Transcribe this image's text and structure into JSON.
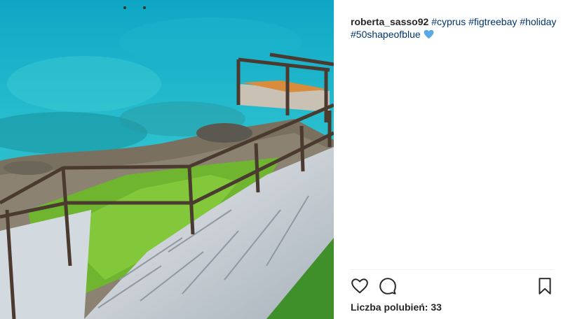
{
  "post": {
    "username": "roberta_sasso92",
    "hashtags": [
      "#cyprus",
      "#figtreebay",
      "#holiday",
      "#50shapeofblue"
    ],
    "emoji": "blue-heart-icon"
  },
  "actions": {
    "like_icon": "heart-outline-icon",
    "comment_icon": "comment-bubble-icon",
    "save_icon": "bookmark-icon"
  },
  "likes": {
    "label": "Liczba polubień:",
    "count": "33"
  },
  "colors": {
    "hashtag": "#003569",
    "text": "#262626",
    "emoji_heart": "#5aa9e6"
  }
}
